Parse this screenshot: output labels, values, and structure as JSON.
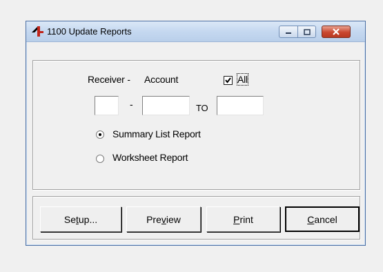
{
  "window": {
    "title": "1100 Update Reports"
  },
  "form": {
    "receiver_label": "Receiver -",
    "account_label": "Account",
    "all_checkbox": {
      "label": "All",
      "checked": true
    },
    "dash": "-",
    "to_label": "TO",
    "receiver_value": "",
    "account_value": "",
    "to_value": "",
    "report_options": [
      {
        "label": "Summary List Report",
        "selected": true
      },
      {
        "label": "Worksheet Report",
        "selected": false
      }
    ]
  },
  "buttons": {
    "setup": {
      "pre": "Se",
      "key": "t",
      "post": "up..."
    },
    "preview": {
      "pre": "Pre",
      "key": "v",
      "post": "iew"
    },
    "print": {
      "pre": "",
      "key": "P",
      "post": "rint"
    },
    "cancel": {
      "pre": "",
      "key": "C",
      "post": "ancel"
    }
  }
}
